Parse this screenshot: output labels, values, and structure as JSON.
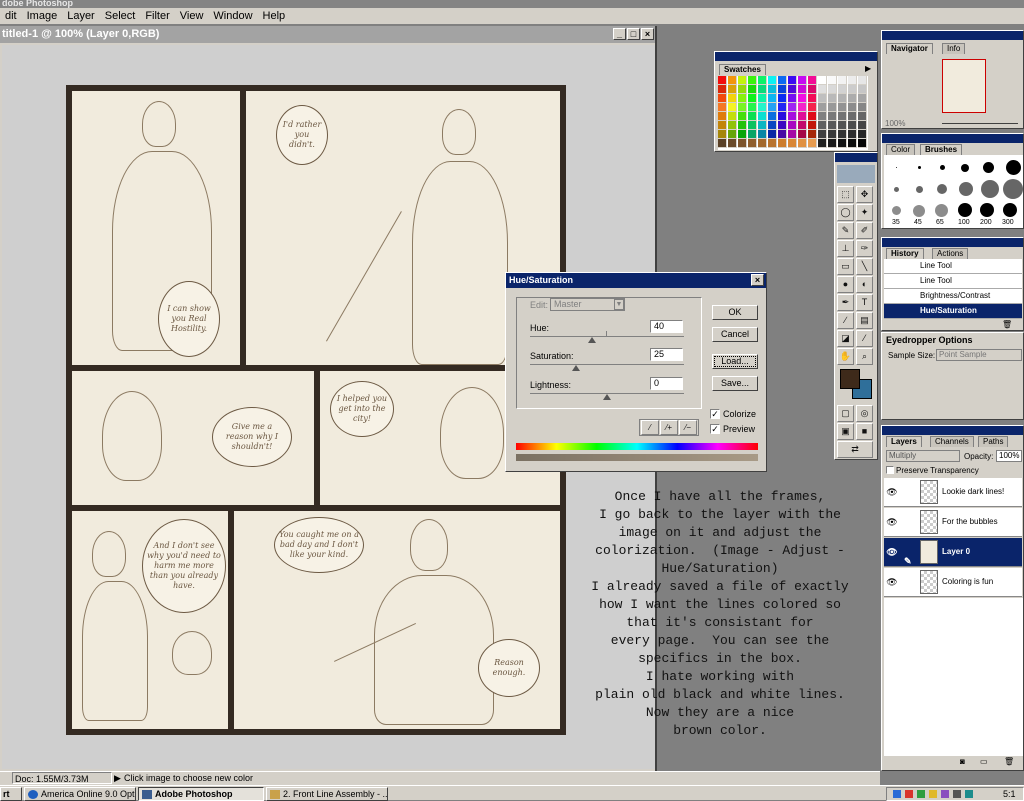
{
  "app": {
    "title": "dobe Photoshop",
    "menus": [
      "dit",
      "Image",
      "Layer",
      "Select",
      "Filter",
      "View",
      "Window",
      "Help"
    ]
  },
  "document": {
    "title": "titled-1 @ 100% (Layer 0,RGB)",
    "min_glyph": "_",
    "max_glyph": "□",
    "close_glyph": "×"
  },
  "comic": {
    "bubbles": [
      "I'd rather you didn't.",
      "I can show you Real Hostility.",
      "Give me a reason why I shouldn't!",
      "I helped you get into the city!",
      "And I don't see why you'd need to harm me more than you already have.",
      "You caught me on a bad day and I don't like your kind.",
      "Reason enough."
    ]
  },
  "huesat": {
    "title": "Hue/Saturation",
    "close_glyph": "×",
    "edit_label": "Edit:",
    "edit_value": "Master",
    "hue_label": "Hue:",
    "hue_value": "40",
    "hue_level": 0.4,
    "saturation_label": "Saturation:",
    "saturation_value": "25",
    "saturation_level": 0.3,
    "lightness_label": "Lightness:",
    "lightness_value": "0",
    "lightness_level": 0.5,
    "ok_label": "OK",
    "cancel_label": "Cancel",
    "load_label": "Load...",
    "save_label": "Save...",
    "colorize_label": "Colorize",
    "colorize_checked": true,
    "preview_label": "Preview",
    "preview_checked": true,
    "check_glyph": "✓"
  },
  "tutorial": {
    "lines": [
      "Once I have all the frames,",
      "I go back to the layer with the",
      "image on it and adjust the",
      "colorization.  (Image - Adjust -",
      "Hue/Saturation)",
      "I already saved a file of exactly",
      "how I want the lines colored so",
      "that it's consistant for",
      "every page.  You can see the",
      "specifics in the box.",
      "I hate working with",
      "plain old black and white lines.",
      "Now they are a nice",
      "brown color."
    ]
  },
  "swatches": {
    "tab": "Swatches"
  },
  "navigator": {
    "tabs": [
      "Navigator",
      "Info"
    ],
    "zoom": "100%"
  },
  "brushes": {
    "tabs": [
      "Color",
      "Brushes"
    ],
    "size_labels": [
      "35",
      "45",
      "65",
      "100",
      "200",
      "300"
    ]
  },
  "history": {
    "tabs": [
      "History",
      "Actions"
    ],
    "items": [
      "Line Tool",
      "Line Tool",
      "Brightness/Contrast",
      "Hue/Saturation"
    ]
  },
  "eyedropper": {
    "title": "Eyedropper Options",
    "sample_label": "Sample Size:",
    "sample_value": "Point Sample"
  },
  "layers": {
    "tabs": [
      "Layers",
      "Channels",
      "Paths"
    ],
    "blend_mode": "Multiply",
    "opacity_label": "Opacity:",
    "opacity_value": "100%",
    "preserve_label": "Preserve Transparency",
    "items": [
      "Lookie dark lines!",
      "For the bubbles",
      "Layer 0",
      "Coloring is fun"
    ]
  },
  "status": {
    "doc_size": "Doc: 1.55M/3.73M",
    "hint": "Click image to choose new color"
  },
  "taskbar": {
    "start": "rt",
    "buttons": [
      "America Online 9.0 Opti...",
      "Adobe Photoshop",
      "2. Front Line Assembly - ..."
    ],
    "clock": "5:1"
  },
  "colors": {
    "foreground": "#3e2a1a",
    "background": "#2f6f9a",
    "title_active": "#0a246a",
    "panel_bg": "#d4d0c8"
  }
}
